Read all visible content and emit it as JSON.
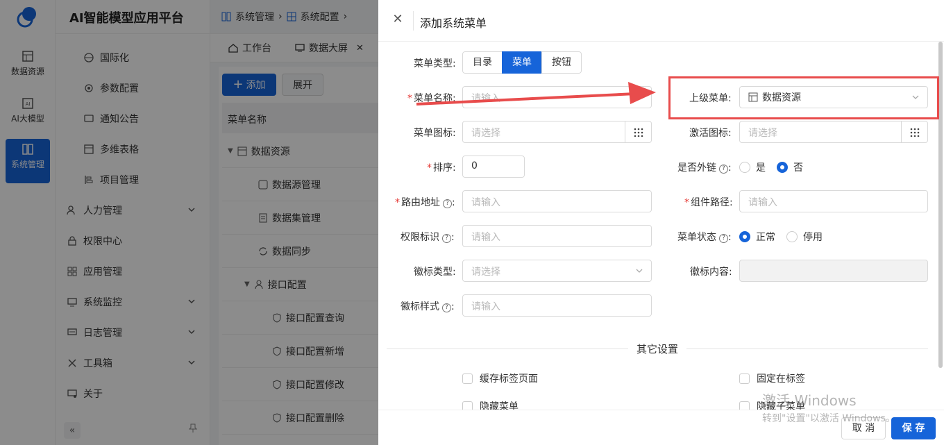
{
  "app": {
    "title": "AI智能模型应用平台"
  },
  "rail": [
    {
      "label": "数据资源",
      "icon": "table-icon"
    },
    {
      "label": "AI大模型",
      "icon": "ai-icon"
    },
    {
      "label": "系统管理",
      "icon": "system-icon",
      "active": true
    }
  ],
  "sidebar": {
    "items": [
      {
        "label": "国际化",
        "icon": "globe-icon"
      },
      {
        "label": "参数配置",
        "icon": "settings-icon"
      },
      {
        "label": "通知公告",
        "icon": "message-icon"
      },
      {
        "label": "多维表格",
        "icon": "table-icon"
      },
      {
        "label": "项目管理",
        "icon": "project-icon"
      },
      {
        "label": "人力管理",
        "icon": "users-icon"
      },
      {
        "label": "权限中心",
        "icon": "lock-icon"
      },
      {
        "label": "应用管理",
        "icon": "apps-icon"
      },
      {
        "label": "系统监控",
        "icon": "monitor-icon"
      },
      {
        "label": "日志管理",
        "icon": "log-icon"
      },
      {
        "label": "工具箱",
        "icon": "tools-icon"
      },
      {
        "label": "关于",
        "icon": "about-icon"
      }
    ],
    "collapse_glyph": "«"
  },
  "breadcrumb": [
    "系统管理",
    "系统配置"
  ],
  "tabs": [
    {
      "label": "工作台",
      "icon": "home-icon"
    },
    {
      "label": "数据大屏",
      "icon": "screen-icon",
      "closable": true
    }
  ],
  "toolbar": {
    "add_label": "添加",
    "expand_label": "展开"
  },
  "table": {
    "header": "菜单名称",
    "rows": [
      {
        "label": "数据资源",
        "level": 0,
        "expanded": true
      },
      {
        "label": "数据源管理",
        "level": 1
      },
      {
        "label": "数据集管理",
        "level": 1
      },
      {
        "label": "数据同步",
        "level": 1
      },
      {
        "label": "接口配置",
        "level": 1,
        "expanded": true
      },
      {
        "label": "接口配置查询",
        "level": 2
      },
      {
        "label": "接口配置新增",
        "level": 2
      },
      {
        "label": "接口配置修改",
        "level": 2
      },
      {
        "label": "接口配置删除",
        "level": 2
      }
    ]
  },
  "drawer": {
    "title": "添加系统菜单",
    "menu_type": {
      "label": "菜单类型:",
      "options": [
        "目录",
        "菜单",
        "按钮"
      ],
      "selected": "菜单"
    },
    "menu_name": {
      "label": "菜单名称:",
      "placeholder": "请输入"
    },
    "parent_menu": {
      "label": "上级菜单:",
      "value": "数据资源"
    },
    "menu_icon": {
      "label": "菜单图标:",
      "placeholder": "请选择"
    },
    "active_icon": {
      "label": "激活图标:",
      "placeholder": "请选择"
    },
    "sort": {
      "label": "排序:",
      "value": "0"
    },
    "external_link": {
      "label": "是否外链",
      "options": [
        "是",
        "否"
      ],
      "selected": "否"
    },
    "route": {
      "label": "路由地址",
      "placeholder": "请输入"
    },
    "component": {
      "label": "组件路径:",
      "placeholder": "请输入"
    },
    "permission": {
      "label": "权限标识",
      "placeholder": "请输入"
    },
    "status": {
      "label": "菜单状态",
      "options": [
        "正常",
        "停用"
      ],
      "selected": "正常"
    },
    "badge_type": {
      "label": "徽标类型:",
      "placeholder": "请选择"
    },
    "badge_content": {
      "label": "徽标内容:"
    },
    "badge_style": {
      "label": "徽标样式",
      "placeholder": "请输入"
    },
    "other_settings": "其它设置",
    "checkboxes": [
      "缓存标签页面",
      "固定在标签",
      "隐藏菜单",
      "隐藏子菜单"
    ],
    "cancel_label": "取 消",
    "save_label": "保 存"
  },
  "watermark": {
    "line1": "激活 Windows",
    "line2": "转到\"设置\"以激活 Windows。"
  },
  "colors": {
    "primary": "#1664d9",
    "annotation": "#e84c4c"
  }
}
